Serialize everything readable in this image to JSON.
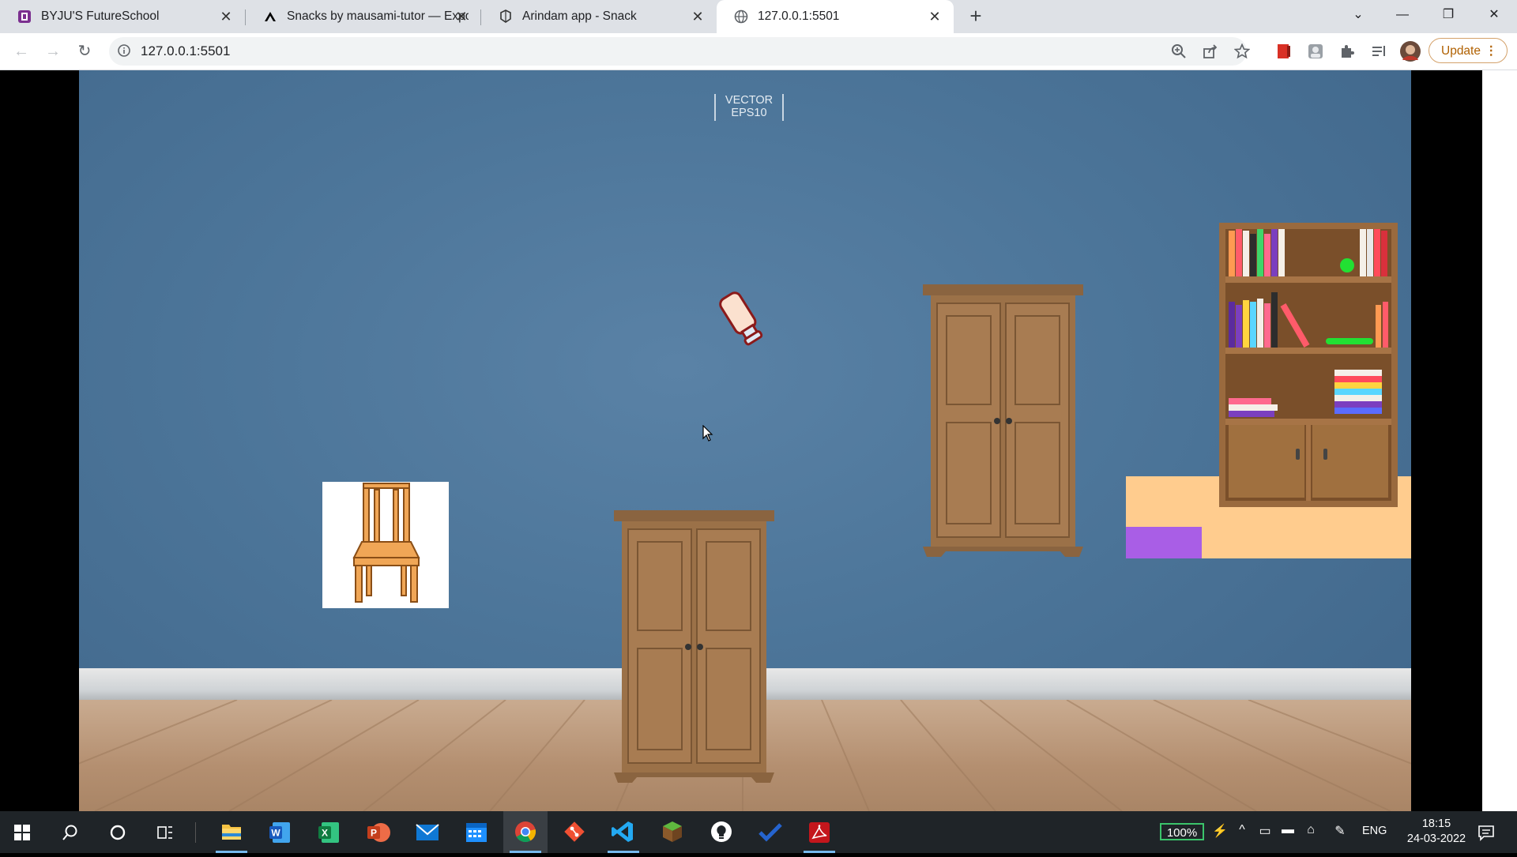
{
  "browser": {
    "tabs": [
      {
        "title": "BYJU'S FutureSchool",
        "favicon": "byjus-icon",
        "active": false
      },
      {
        "title": "Snacks by mausami-tutor — Expo",
        "favicon": "expo-icon",
        "active": false
      },
      {
        "title": "Arindam app - Snack",
        "favicon": "snack-icon",
        "active": false
      },
      {
        "title": "127.0.0.1:5501",
        "favicon": "globe-icon",
        "active": true
      }
    ],
    "new_tab": "+",
    "window_controls": {
      "minimize": "—",
      "restore": "❐",
      "close": "✕"
    },
    "url": "127.0.0.1:5501",
    "update_label": "Update"
  },
  "page": {
    "watermark": {
      "line1": "VECTOR",
      "line2": "EPS10"
    },
    "colors": {
      "wall": "#4c7599",
      "floor": "#b48f70",
      "shelf_panel": "#ffcc8e",
      "purple_box": "#a95ee6"
    }
  },
  "taskbar": {
    "apps": [
      {
        "name": "file-explorer-icon",
        "running": true
      },
      {
        "name": "word-icon",
        "running": false
      },
      {
        "name": "excel-icon",
        "running": false
      },
      {
        "name": "powerpoint-icon",
        "running": false
      },
      {
        "name": "mail-icon",
        "running": false
      },
      {
        "name": "calendar-icon",
        "running": false
      },
      {
        "name": "chrome-icon",
        "running": true
      },
      {
        "name": "git-icon",
        "running": false
      },
      {
        "name": "vscode-icon",
        "running": true
      },
      {
        "name": "minecraft-icon",
        "running": false
      },
      {
        "name": "bulb-app-icon",
        "running": false
      },
      {
        "name": "todo-icon",
        "running": false
      },
      {
        "name": "acrobat-icon",
        "running": true
      }
    ],
    "battery": "100%",
    "language": "ENG",
    "time": "18:15",
    "date": "24-03-2022"
  }
}
